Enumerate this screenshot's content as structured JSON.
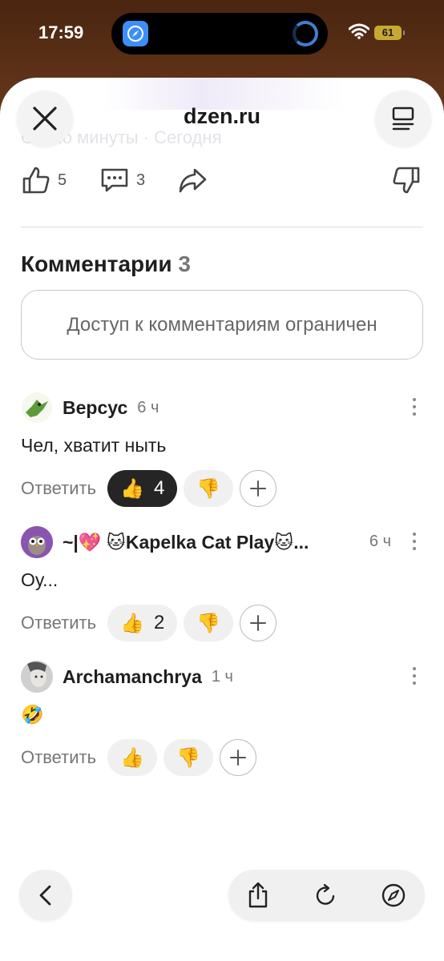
{
  "status_bar": {
    "time": "17:59",
    "battery": "61"
  },
  "page": {
    "site": "dzen.ru",
    "faded_header": "Около минуты · Сегодня"
  },
  "actions": {
    "likes": "5",
    "comments": "3"
  },
  "comments_section": {
    "title": "Комментарии",
    "count": "3",
    "restricted_text": "Доступ к комментариям ограничен"
  },
  "comments": [
    {
      "author": "Версус",
      "time": "6 ч",
      "text": "Чел, хватит ныть",
      "reply_label": "Ответить",
      "like_emoji": "👍",
      "dislike_emoji": "👎",
      "like_count": "4"
    },
    {
      "author": "~|💖 🐱Kapelka Cat Play🐱...",
      "time": "6 ч",
      "text": "Оу...",
      "reply_label": "Ответить",
      "like_emoji": "👍",
      "dislike_emoji": "👎",
      "like_count": "2"
    },
    {
      "author": "Archamanchrya",
      "time": "1 ч",
      "text": "🤣",
      "reply_label": "Ответить",
      "like_emoji": "👍",
      "dislike_emoji": "👎",
      "like_count": ""
    }
  ],
  "icons": {
    "close": "close-icon",
    "menu": "reader-menu-icon",
    "like": "thumbs-up-icon",
    "comment": "comment-icon",
    "share": "share-arrow-icon",
    "dislike": "thumbs-down-icon",
    "back": "chevron-left-icon",
    "share_sheet": "share-icon",
    "reload": "reload-icon",
    "compass": "compass-icon"
  }
}
